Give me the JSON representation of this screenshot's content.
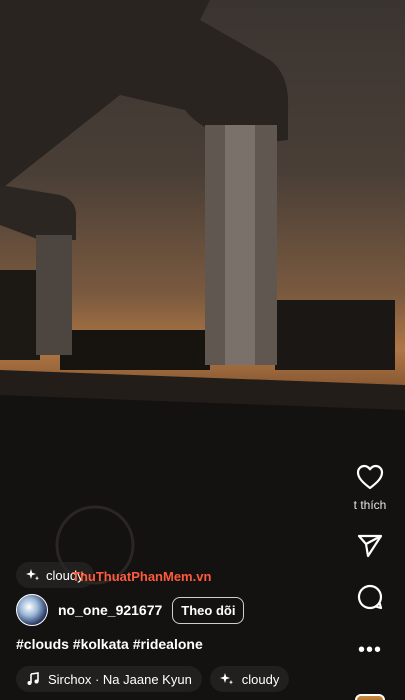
{
  "post": {
    "username": "no_one_921677",
    "follow_label": "Theo dõi",
    "caption": "#clouds #kolkata #ridealone"
  },
  "chips": {
    "effect_top": "cloudy",
    "effect_bottom": "cloudy"
  },
  "music": {
    "label": "Sirchox · Na Jaane Kyun"
  },
  "rail": {
    "like_label": "t thích"
  },
  "watermark": "ThuThuatPhanMem.vn",
  "colors": {
    "accent": "#ff5a3c",
    "text": "#ffffff"
  },
  "icons": [
    "heart-icon",
    "send-icon",
    "comment-icon",
    "more-icon",
    "music-note-icon",
    "sparkle-icon"
  ]
}
